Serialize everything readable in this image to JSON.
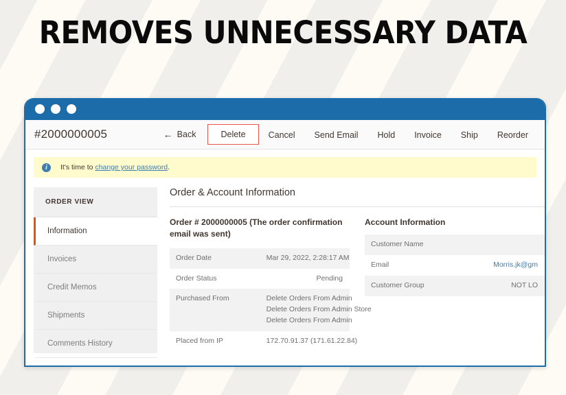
{
  "headline": "REMOVES UNNECESSARY DATA",
  "window": {
    "accent_blue": "#1B6CA8",
    "dots": [
      "dot",
      "dot",
      "dot"
    ]
  },
  "toolbar": {
    "order_id": "#2000000005",
    "back_label": "Back",
    "back_arrow": "←",
    "actions": [
      {
        "label": "Delete",
        "style": "danger"
      },
      {
        "label": "Cancel",
        "style": "plain"
      },
      {
        "label": "Send Email",
        "style": "plain"
      },
      {
        "label": "Hold",
        "style": "plain"
      },
      {
        "label": "Invoice",
        "style": "plain"
      },
      {
        "label": "Ship",
        "style": "plain"
      },
      {
        "label": "Reorder",
        "style": "plain"
      }
    ]
  },
  "notice": {
    "icon": "info-icon",
    "icon_glyph": "i",
    "text_before": "It's time to ",
    "link_text": "change your password",
    "text_after": ".",
    "background": "#FFFBCC",
    "link_color": "#3E7CB1"
  },
  "sidebar": {
    "title": "ORDER VIEW",
    "active_accent": "#EB5202",
    "items": [
      {
        "label": "Information",
        "active": true
      },
      {
        "label": "Invoices",
        "active": false
      },
      {
        "label": "Credit Memos",
        "active": false
      },
      {
        "label": "Shipments",
        "active": false
      },
      {
        "label": "Comments History",
        "active": false
      }
    ]
  },
  "content": {
    "heading": "Order & Account Information",
    "order_section": {
      "title": "Order # 2000000005 (The order confirmation email was sent)",
      "rows": [
        {
          "key": "Order Date",
          "value": "Mar 29, 2022, 2:28:17 AM",
          "alt": true
        },
        {
          "key": "Order Status",
          "value": "Pending",
          "alt": false
        },
        {
          "key": "Purchased From",
          "value_lines": [
            "Delete Orders From Admin",
            "Delete Orders From Admin Store",
            "Delete Orders From Admin"
          ],
          "alt": true
        },
        {
          "key": "Placed from IP",
          "value": "172.70.91.37 (171.61.22.84)",
          "alt": false
        }
      ]
    },
    "account_section": {
      "title": "Account Information",
      "rows": [
        {
          "key": "Customer Name",
          "value": "",
          "alt": true
        },
        {
          "key": "Email",
          "value": "Morris.jk@gm",
          "alt": false,
          "link": true
        },
        {
          "key": "Customer Group",
          "value": "NOT LO",
          "alt": true
        }
      ]
    }
  }
}
